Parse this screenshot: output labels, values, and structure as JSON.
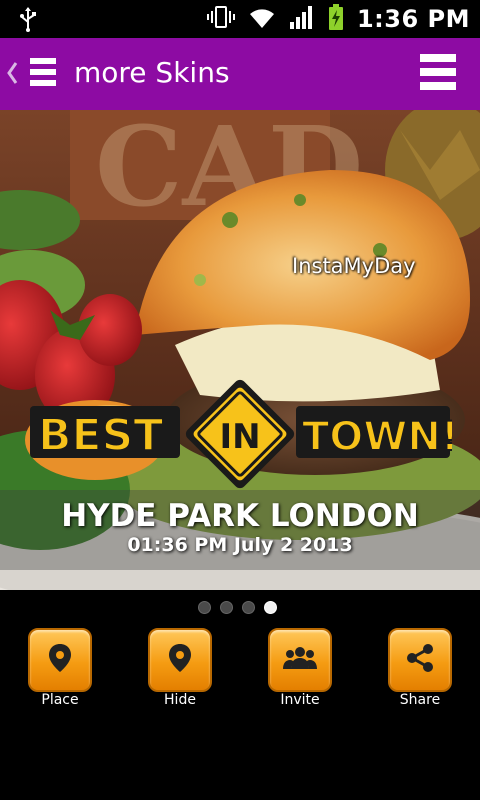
{
  "status_bar": {
    "time": "1:36 PM",
    "icons": [
      "usb-icon",
      "vibrate-icon",
      "wifi-icon",
      "signal-icon",
      "battery-charging-icon"
    ]
  },
  "header": {
    "title": "more Skins",
    "accent_color": "#8d0ba3"
  },
  "photo": {
    "watermark": "InstaMyDay",
    "location": "HYDE PARK LONDON",
    "datetime": "01:36 PM July 2 2013",
    "logo_text": {
      "left": "BEST",
      "middle": "IN",
      "right": "TOWN!"
    }
  },
  "pager": {
    "total": 4,
    "active_index": 3
  },
  "actions": [
    {
      "label": "Place",
      "icon": "location-pin-icon"
    },
    {
      "label": "Hide",
      "icon": "location-pin-icon"
    },
    {
      "label": "Invite",
      "icon": "people-icon"
    },
    {
      "label": "Share",
      "icon": "share-icon"
    }
  ],
  "colors": {
    "button_orange": "#f59c12",
    "logo_yellow": "#f7c21a"
  }
}
